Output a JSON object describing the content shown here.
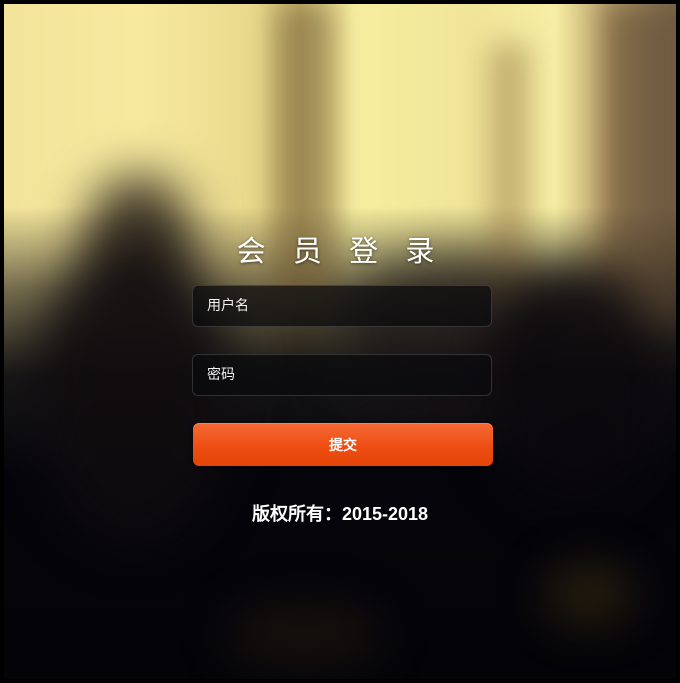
{
  "login": {
    "title": "会 员 登 录",
    "username_placeholder": "用户名",
    "password_placeholder": "密码",
    "submit_label": "提交"
  },
  "footer": {
    "copyright": "版权所有：2015-2018"
  },
  "colors": {
    "button_accent": "#ee4e14",
    "background_dark": "#0a0a0e",
    "background_light": "#f6ee9f"
  }
}
